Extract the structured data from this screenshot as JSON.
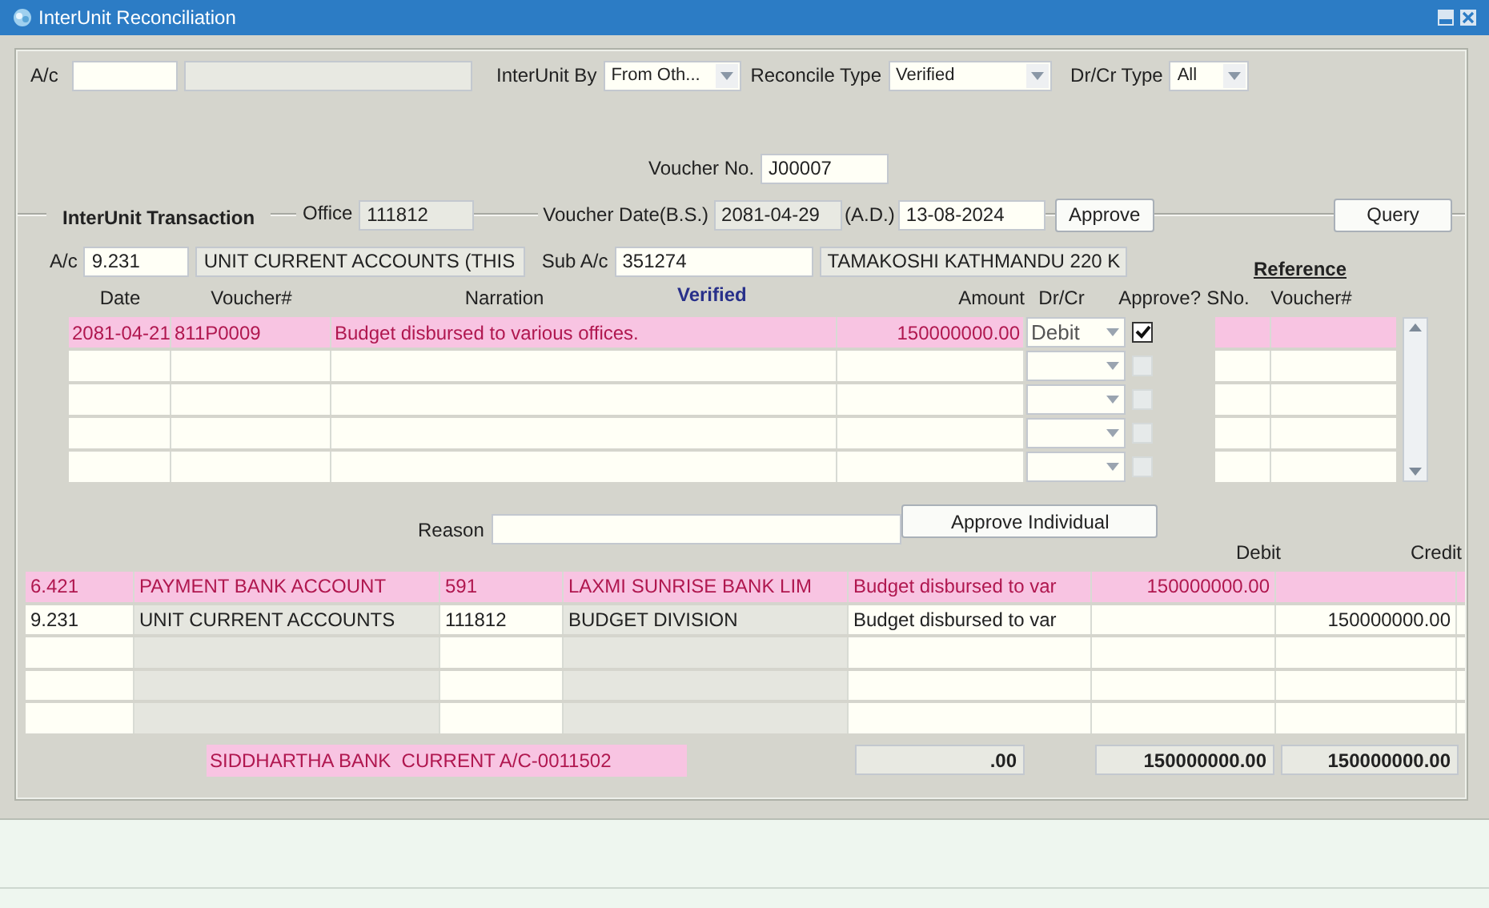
{
  "window": {
    "title": "InterUnit Reconciliation"
  },
  "filters": {
    "ac_label": "A/c",
    "interunit_by_label": "InterUnit By",
    "interunit_by": "From Oth...",
    "reconcile_type_label": "Reconcile Type",
    "reconcile_type": "Verified",
    "drcr_type_label": "Dr/Cr Type",
    "drcr_type": "All"
  },
  "voucher": {
    "label": "Voucher No.",
    "value": "J00007"
  },
  "transaction": {
    "section_title": "InterUnit Transaction",
    "office_label": "Office",
    "office": "111812",
    "voucher_date_label": "Voucher Date(B.S.)",
    "date_bs": "2081-04-29",
    "ad_label": "(A.D.)",
    "date_ad": "13-08-2024",
    "approve_button": "Approve",
    "query_button": "Query",
    "ac_label": "A/c",
    "ac": "9.231",
    "ac_name": "UNIT CURRENT ACCOUNTS (THIS",
    "sub_ac_label": "Sub A/c",
    "sub_ac": "351274",
    "sub_ac_name": "TAMAKOSHI KATHMANDU 220 K"
  },
  "grid": {
    "status": "Verified",
    "reference_label": "Reference",
    "columns": [
      "Date",
      "Voucher#",
      "Narration",
      "Amount",
      "Dr/Cr",
      "Approve?",
      "SNo.",
      "Voucher#"
    ],
    "rows": [
      {
        "selected": true,
        "date": "2081-04-21",
        "voucher": "811P0009",
        "narration": "Budget disbursed to various offices.",
        "amount": "150000000.00",
        "drcr": "Debit",
        "approved": true
      },
      {
        "selected": false,
        "approved": false
      },
      {
        "selected": false,
        "approved": false
      },
      {
        "selected": false,
        "approved": false
      },
      {
        "selected": false,
        "approved": false
      }
    ]
  },
  "reason": {
    "label": "Reason"
  },
  "approve_individual_button": "Approve Individual",
  "entries": {
    "columns": [
      "Debit",
      "Credit"
    ],
    "rows": [
      {
        "selected": true,
        "column_1": "6.421",
        "column_2": "PAYMENT BANK ACCOUNT",
        "column_3": "591",
        "column_4": "LAXMI SUNRISE BANK LIM",
        "column_5": "Budget disbursed to var",
        "debit": "150000000.00"
      },
      {
        "selected": false,
        "column_1": "9.231",
        "column_2": "UNIT CURRENT ACCOUNTS",
        "column_3": "111812",
        "column_4": "BUDGET DIVISION",
        "column_5": "Budget disbursed to var",
        "credit": "150000000.00"
      },
      {
        "selected": false
      },
      {
        "selected": false
      },
      {
        "selected": false
      }
    ]
  },
  "footer": {
    "bank_name": "SIDDHARTHA BANK  CURRENT A/C-0011502",
    "difference": ".00",
    "debit_total": "150000000.00",
    "credit_total": "150000000.00"
  }
}
